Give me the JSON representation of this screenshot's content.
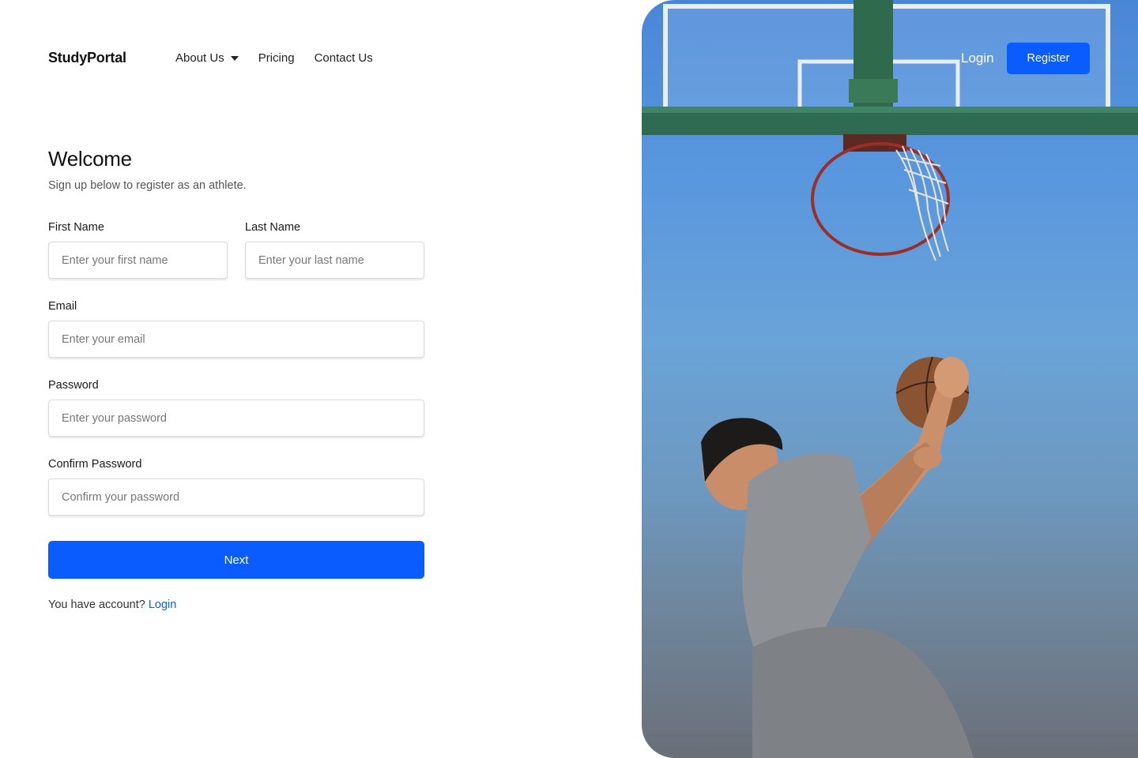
{
  "brand": {
    "name": "StudyPortal"
  },
  "nav": {
    "about_label": "About Us",
    "pricing_label": "Pricing",
    "contact_label": "Contact Us"
  },
  "auth": {
    "login_label": "Login",
    "register_label": "Register"
  },
  "form": {
    "title": "Welcome",
    "subtitle": "Sign up below to register as an athlete.",
    "first_name": {
      "label": "First Name",
      "placeholder": "Enter your first name",
      "value": ""
    },
    "last_name": {
      "label": "Last Name",
      "placeholder": "Enter your last name",
      "value": ""
    },
    "email": {
      "label": "Email",
      "placeholder": "Enter your email",
      "value": ""
    },
    "password": {
      "label": "Password",
      "placeholder": "Enter your password",
      "value": ""
    },
    "confirm_password": {
      "label": "Confirm Password",
      "placeholder": "Confirm your password",
      "value": ""
    },
    "submit_label": "Next",
    "footer_text": "You have account?",
    "footer_link": "Login"
  },
  "colors": {
    "accent": "#0a5cff",
    "text": "#1a1a1a",
    "muted": "#555555"
  }
}
